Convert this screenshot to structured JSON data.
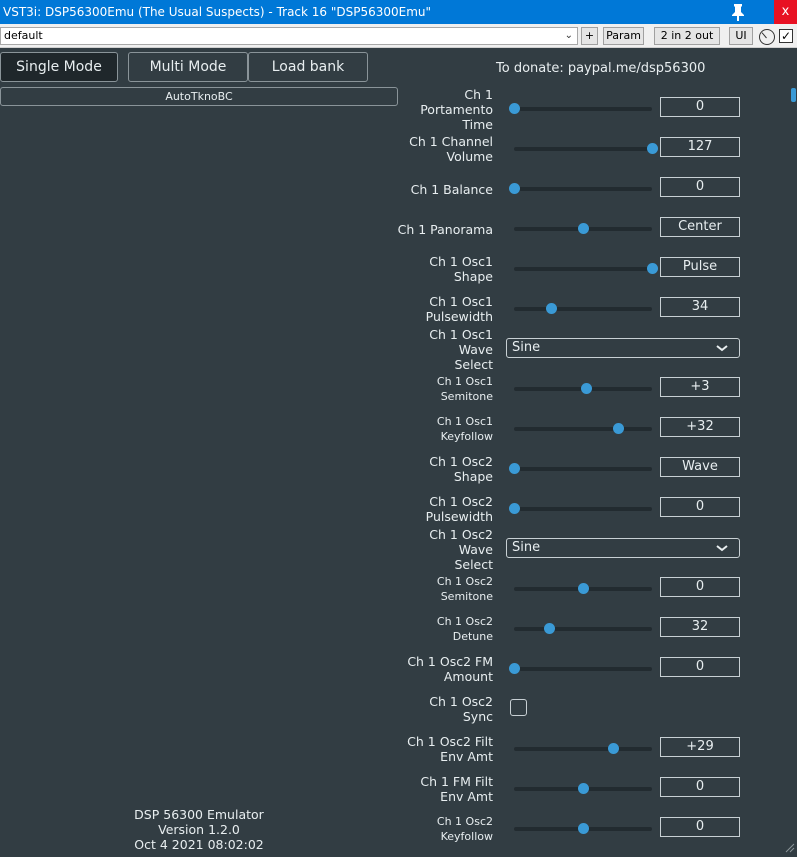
{
  "window": {
    "title": "VST3i: DSP56300Emu (The Usual Suspects) - Track 16 \"DSP56300Emu\"",
    "close_label": "x"
  },
  "toolbar": {
    "preset": "default",
    "plus_label": "+",
    "param_label": "Param",
    "io_label": "2 in 2 out",
    "ui_label": "UI",
    "bypass_checked": "☑"
  },
  "plugin": {
    "modes": {
      "single": "Single Mode",
      "multi": "Multi Mode",
      "load_bank": "Load bank"
    },
    "donate_text": "To donate: paypal.me/dsp56300",
    "patch_name": "AutoTknoBC",
    "version_text": "DSP 56300 Emulator\nVersion 1.2.0\nOct  4 2021 08:02:02",
    "accent_color": "#3a9ad6"
  },
  "params": [
    {
      "label": "Ch 1 Portamento\nTime",
      "type": "slider",
      "fraction": 0.0,
      "value": "0",
      "small": false
    },
    {
      "label": "Ch 1 Channel\nVolume",
      "type": "slider",
      "fraction": 1.0,
      "value": "127",
      "small": false
    },
    {
      "label": "Ch 1 Balance",
      "type": "slider",
      "fraction": 0.0,
      "value": "0",
      "small": false
    },
    {
      "label": "Ch 1 Panorama",
      "type": "slider",
      "fraction": 0.5,
      "value": "Center",
      "small": false
    },
    {
      "label": "Ch 1 Osc1 Shape",
      "type": "slider",
      "fraction": 1.0,
      "value": "Pulse",
      "small": false
    },
    {
      "label": "Ch 1 Osc1\nPulsewidth",
      "type": "slider",
      "fraction": 0.27,
      "value": "34",
      "small": false
    },
    {
      "label": "Ch 1 Osc1 Wave\nSelect",
      "type": "combo",
      "value": "Sine",
      "small": false
    },
    {
      "label": "Ch 1 Osc1 Semitone",
      "type": "slider",
      "fraction": 0.52,
      "value": "+3",
      "small": true
    },
    {
      "label": "Ch 1 Osc1 Keyfollow",
      "type": "slider",
      "fraction": 0.75,
      "value": "+32",
      "small": true
    },
    {
      "label": "Ch 1 Osc2 Shape",
      "type": "slider",
      "fraction": 0.0,
      "value": "Wave",
      "small": false
    },
    {
      "label": "Ch 1 Osc2\nPulsewidth",
      "type": "slider",
      "fraction": 0.0,
      "value": "0",
      "small": false
    },
    {
      "label": "Ch 1 Osc2 Wave\nSelect",
      "type": "combo",
      "value": "Sine",
      "small": false
    },
    {
      "label": "Ch 1 Osc2 Semitone",
      "type": "slider",
      "fraction": 0.5,
      "value": "0",
      "small": true
    },
    {
      "label": "Ch 1 Osc2 Detune",
      "type": "slider",
      "fraction": 0.25,
      "value": "32",
      "small": true
    },
    {
      "label": "Ch 1 Osc2 FM\nAmount",
      "type": "slider",
      "fraction": 0.0,
      "value": "0",
      "small": false
    },
    {
      "label": "Ch 1 Osc2 Sync",
      "type": "checkbox",
      "checked": false,
      "small": false
    },
    {
      "label": "Ch 1 Osc2 Filt\nEnv Amt",
      "type": "slider",
      "fraction": 0.72,
      "value": "+29",
      "small": false
    },
    {
      "label": "Ch 1 FM Filt\nEnv Amt",
      "type": "slider",
      "fraction": 0.5,
      "value": "0",
      "small": false
    },
    {
      "label": "Ch 1 Osc2 Keyfollow",
      "type": "slider",
      "fraction": 0.5,
      "value": "0",
      "small": true
    }
  ]
}
